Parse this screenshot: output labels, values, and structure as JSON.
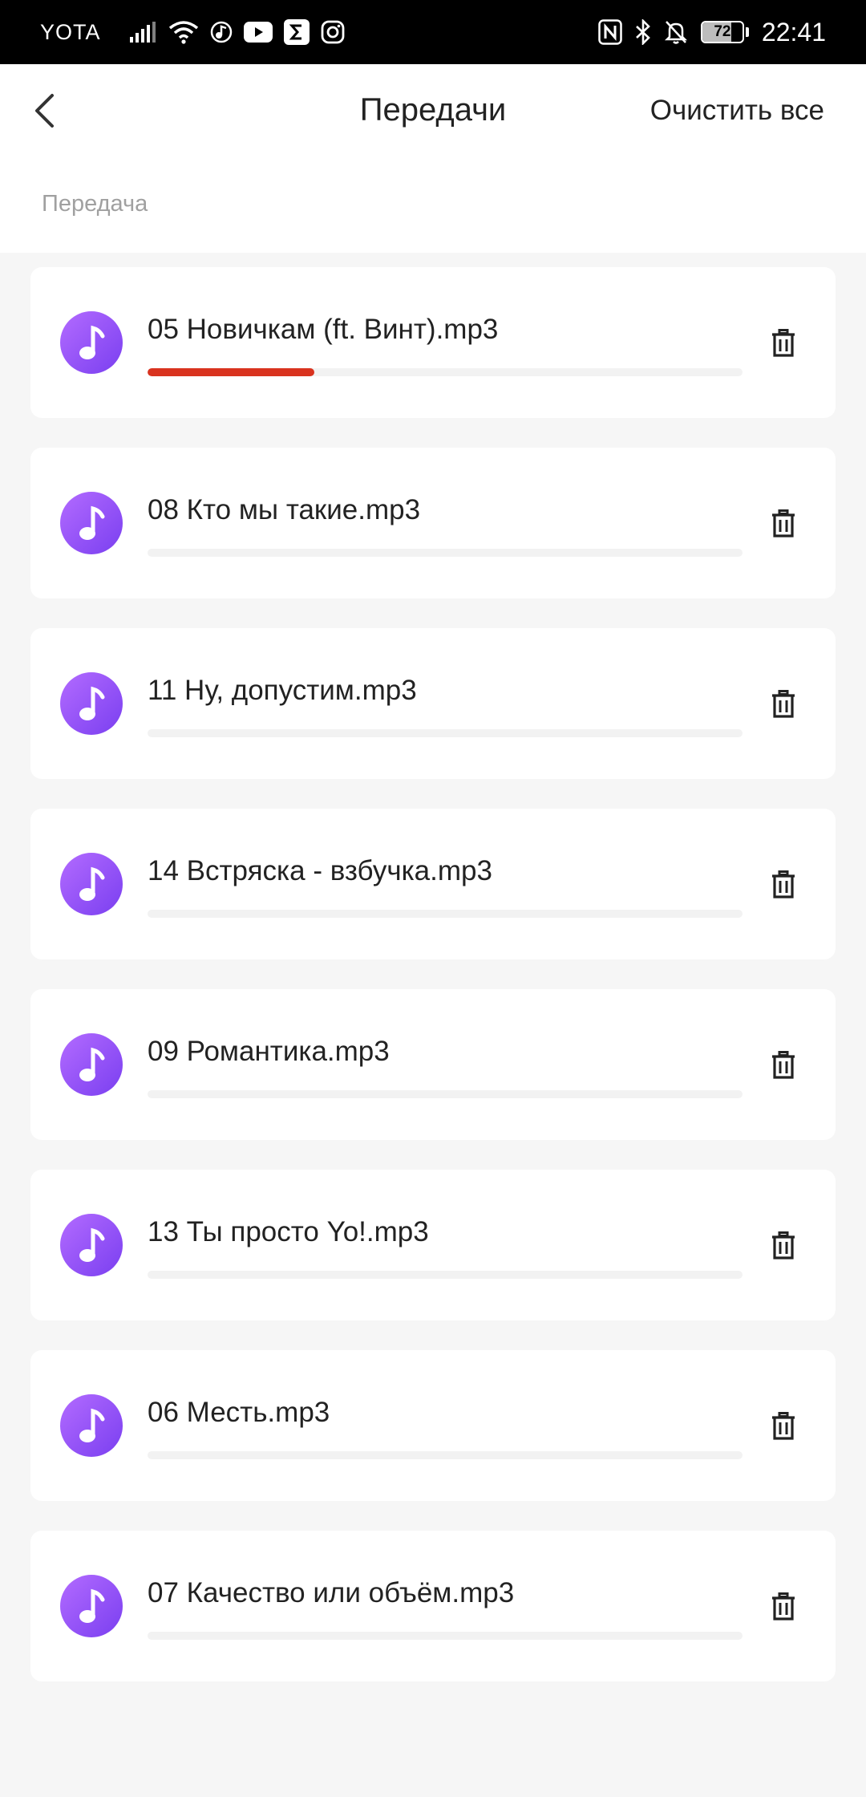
{
  "status_bar": {
    "carrier": "YOTA",
    "battery_level": 72,
    "battery_text": "72",
    "time": "22:41"
  },
  "header": {
    "title": "Передачи",
    "clear_all_label": "Очистить все",
    "back_icon": "chevron-left-icon"
  },
  "section": {
    "label": "Передача"
  },
  "colors": {
    "accent": "#d9331f",
    "icon_gradient_start": "#b36bff",
    "icon_gradient_end": "#7a3ff0"
  },
  "transfers": [
    {
      "name": "05 Новичкам (ft. Винт).mp3",
      "progress": 0.28
    },
    {
      "name": "08 Кто мы такие.mp3",
      "progress": 0
    },
    {
      "name": "11 Ну, допустим.mp3",
      "progress": 0
    },
    {
      "name": "14 Встряска - взбучка.mp3",
      "progress": 0
    },
    {
      "name": "09 Романтика.mp3",
      "progress": 0
    },
    {
      "name": "13 Ты просто Yo!.mp3",
      "progress": 0
    },
    {
      "name": "06 Месть.mp3",
      "progress": 0
    },
    {
      "name": "07 Качество или объём.mp3",
      "progress": 0
    }
  ]
}
